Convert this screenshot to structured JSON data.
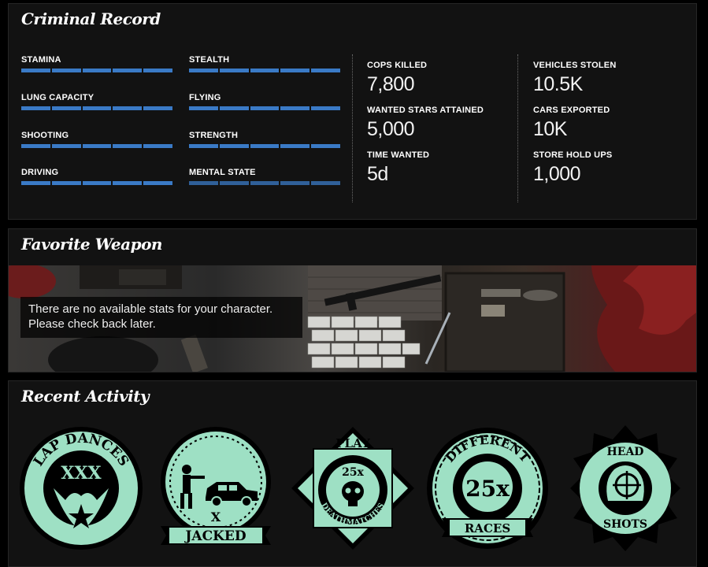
{
  "criminal_record": {
    "title": "Criminal Record",
    "skills": [
      {
        "label": "STAMINA",
        "level": 1.0
      },
      {
        "label": "STEALTH",
        "level": 1.0
      },
      {
        "label": "LUNG CAPACITY",
        "level": 1.0
      },
      {
        "label": "FLYING",
        "level": 1.0
      },
      {
        "label": "SHOOTING",
        "level": 1.0
      },
      {
        "label": "STRENGTH",
        "level": 1.0
      },
      {
        "label": "DRIVING",
        "level": 1.0
      },
      {
        "label": "MENTAL STATE",
        "level": 1.0
      }
    ],
    "stats_left": [
      {
        "label": "COPS KILLED",
        "value": "7,800"
      },
      {
        "label": "WANTED STARS ATTAINED",
        "value": "5,000"
      },
      {
        "label": "TIME WANTED",
        "value": "5d"
      }
    ],
    "stats_right": [
      {
        "label": "VEHICLES STOLEN",
        "value": "10.5K"
      },
      {
        "label": "CARS EXPORTED",
        "value": "10K"
      },
      {
        "label": "STORE HOLD UPS",
        "value": "1,000"
      }
    ],
    "colors": {
      "bar": "#3a7ac6",
      "bar_dim": "#2a5a9c"
    }
  },
  "favorite_weapon": {
    "title": "Favorite Weapon",
    "message_line1": "There are no available stats for your character.",
    "message_line2": "Please check back later."
  },
  "recent_activity": {
    "title": "Recent Activity",
    "badge_color": "#9ee0c4",
    "badges": [
      {
        "icon": "lap-dances-icon",
        "top_text": "LAP DANCES",
        "center_text": "XXX"
      },
      {
        "icon": "jacked-icon",
        "center_text": "X",
        "bottom_text": "JACKED"
      },
      {
        "icon": "deathmatches-icon",
        "top_text": "PLAY",
        "center_text": "25x",
        "bottom_text": "DEATHMATCHES"
      },
      {
        "icon": "races-icon",
        "top_text": "DIFFERENT",
        "center_text": "25x",
        "bottom_text": "RACES"
      },
      {
        "icon": "headshots-icon",
        "top_text": "HEAD",
        "bottom_text": "SHOTS"
      }
    ]
  }
}
